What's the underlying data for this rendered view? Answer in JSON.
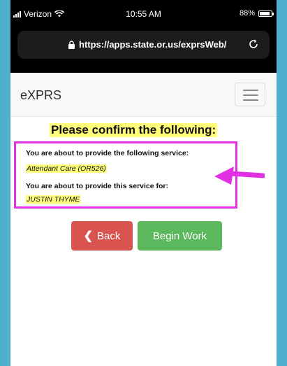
{
  "status_bar": {
    "carrier": "Verizon",
    "time": "10:55 AM",
    "battery": "88%",
    "battery_level": 0.88
  },
  "browser": {
    "url": "https://apps.state.or.us/exprsWeb/"
  },
  "navbar": {
    "brand": "eXPRS"
  },
  "page": {
    "title": "Please confirm the following:",
    "service_label": "You are about to provide the following service:",
    "service_value": "Attendant Care (OR526)",
    "client_label": "You are about to provide this service for:",
    "client_value": "JUSTIN THYME",
    "back_label": "Back",
    "begin_label": "Begin Work"
  },
  "colors": {
    "highlight": "#fffd7a",
    "annotation": "#e231e5",
    "back_button": "#d9534f",
    "begin_button": "#5cb85c"
  }
}
